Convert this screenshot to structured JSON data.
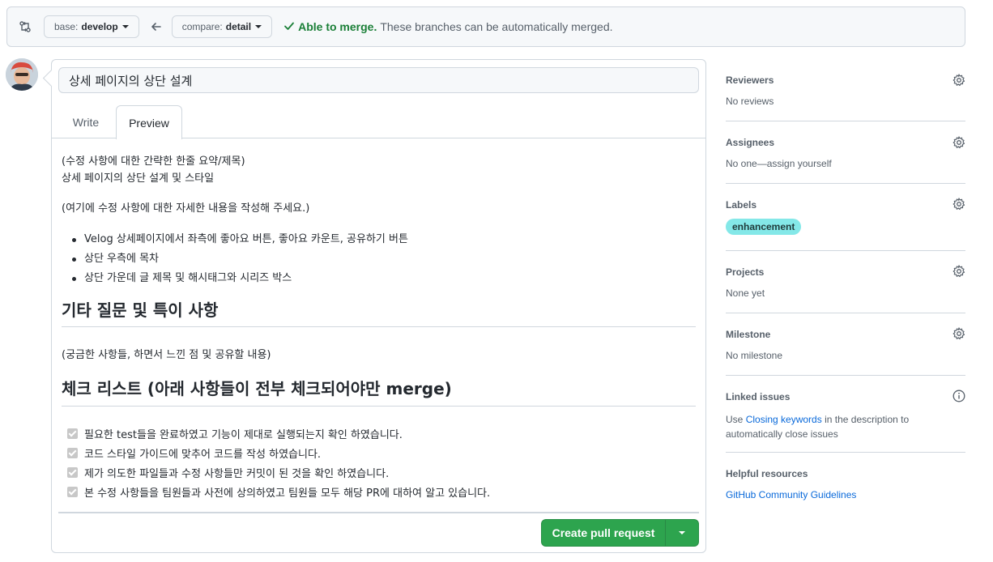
{
  "compare": {
    "base_prefix": "base:",
    "base_branch": "develop",
    "compare_prefix": "compare:",
    "compare_branch": "detail",
    "merge_ok": "Able to merge.",
    "merge_desc": "These branches can be automatically merged."
  },
  "pr": {
    "title": "상세 페이지의 상단 설계",
    "tab_write": "Write",
    "tab_preview": "Preview",
    "summary_heading": "(수정 사항에 대한 간략한 한줄 요약/제목)",
    "summary_text": "상세 페이지의 상단 설계 및 스타일",
    "detail_prompt": "(여기에 수정 사항에 대한 자세한 내용을 작성해 주세요.)",
    "bullets": [
      "Velog 상세페이지에서 좌측에 좋아요 버튼, 좋아요 카운트, 공유하기 버튼",
      "상단 우측에 목차",
      "상단 가운데 글 제목 및 해시태그와 시리즈 박스"
    ],
    "h2_questions": "기타 질문 및 특이 사항",
    "questions_text": "(궁금한 사항들, 하면서 느낀 점 및 공유할 내용)",
    "h2_checklist": "체크 리스트 (아래 사항들이 전부 체크되어야만 merge)",
    "tasks": [
      "필요한 test들을 완료하였고 기능이 제대로 실행되는지 확인 하였습니다.",
      "코드 스타일 가이드에 맞추어 코드를 작성 하였습니다.",
      "제가 의도한 파일들과 수정 사항들만 커밋이 된 것을 확인 하였습니다.",
      "본 수정 사항들을 팀원들과 사전에 상의하였고 팀원들 모두 해당 PR에 대하여 알고 있습니다."
    ],
    "create_button": "Create pull request"
  },
  "sidebar": {
    "reviewers_title": "Reviewers",
    "reviewers_value": "No reviews",
    "assignees_title": "Assignees",
    "assignees_value": "No one—assign yourself",
    "labels_title": "Labels",
    "label_name": "enhancement",
    "label_color": "#84e8e8",
    "projects_title": "Projects",
    "projects_value": "None yet",
    "milestone_title": "Milestone",
    "milestone_value": "No milestone",
    "linked_title": "Linked issues",
    "linked_pre": "Use",
    "linked_link": "Closing keywords",
    "linked_post": "in the description to",
    "linked_post2": "automatically close issues",
    "help_title": "Helpful resources",
    "help_link": "GitHub Community Guidelines"
  }
}
